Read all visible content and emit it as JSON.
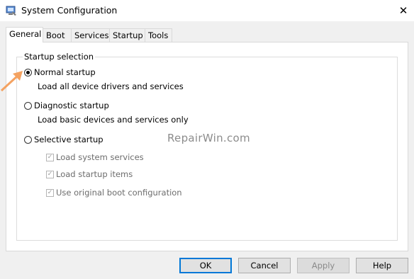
{
  "window": {
    "title": "System Configuration",
    "close_glyph": "✕"
  },
  "tabs": [
    {
      "label": "General",
      "active": true
    },
    {
      "label": "Boot"
    },
    {
      "label": "Services"
    },
    {
      "label": "Startup"
    },
    {
      "label": "Tools"
    }
  ],
  "startup_selection": {
    "label": "Startup selection",
    "selected": "normal",
    "normal": {
      "label": "Normal startup",
      "description": "Load all device drivers and services"
    },
    "diagnostic": {
      "label": "Diagnostic startup",
      "description": "Load basic devices and services only"
    },
    "selective": {
      "label": "Selective startup",
      "options": [
        {
          "label": "Load system services",
          "checked": true,
          "enabled": false
        },
        {
          "label": "Load startup items",
          "checked": true,
          "enabled": false
        },
        {
          "label": "Use original boot configuration",
          "checked": true,
          "enabled": false
        }
      ]
    }
  },
  "watermark": "RepairWin.com",
  "buttons": {
    "ok": "OK",
    "cancel": "Cancel",
    "apply": "Apply",
    "help": "Help"
  },
  "colors": {
    "accent": "#0078d7",
    "annotation_arrow": "#f4a261"
  },
  "icons": {
    "app": "system-config-icon",
    "check": "✓"
  }
}
